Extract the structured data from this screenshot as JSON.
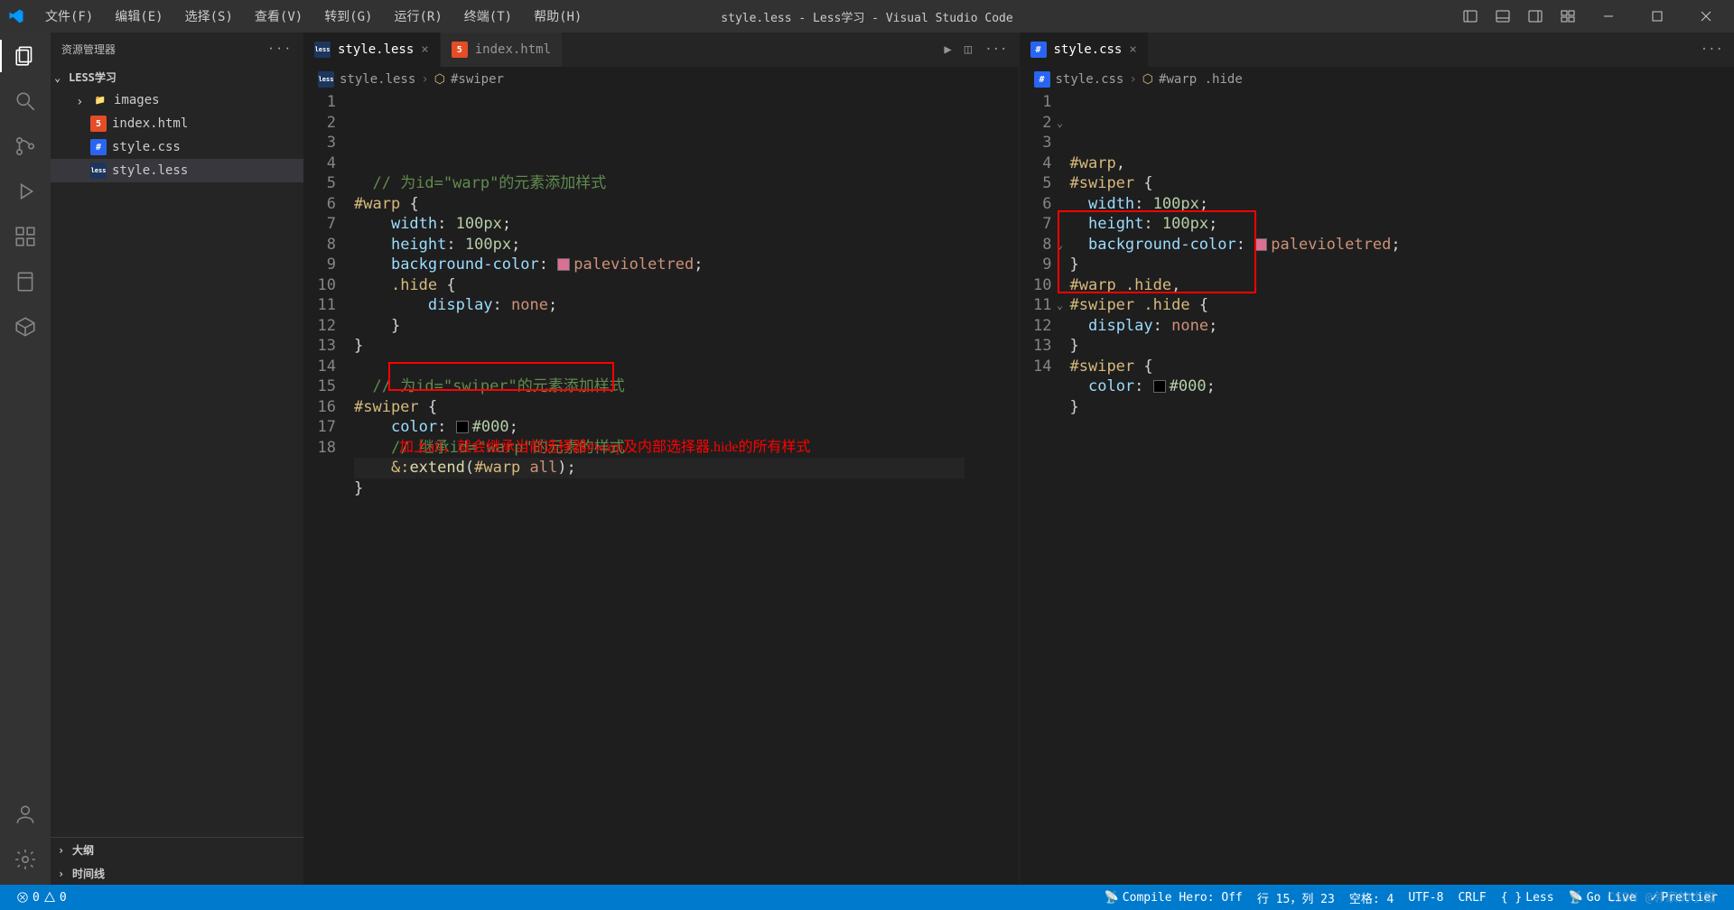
{
  "title": "style.less - Less学习 - Visual Studio Code",
  "menu": [
    "文件(F)",
    "编辑(E)",
    "选择(S)",
    "查看(V)",
    "转到(G)",
    "运行(R)",
    "终端(T)",
    "帮助(H)"
  ],
  "sidebar": {
    "header": "资源管理器",
    "folder": "LESS学习",
    "items": [
      {
        "label": "images",
        "icon": "folder",
        "indent": 1,
        "chev": true
      },
      {
        "label": "index.html",
        "icon": "html",
        "indent": 2,
        "chev": false
      },
      {
        "label": "style.css",
        "icon": "css",
        "indent": 2,
        "chev": false
      },
      {
        "label": "style.less",
        "icon": "less",
        "indent": 2,
        "chev": false,
        "selected": true
      }
    ],
    "collapse": [
      "大纲",
      "时间线"
    ]
  },
  "left_editor": {
    "tabs": [
      {
        "label": "style.less",
        "icon": "less",
        "active": true,
        "closable": true
      },
      {
        "label": "index.html",
        "icon": "html",
        "active": false,
        "closable": false
      }
    ],
    "breadcrumb": [
      "style.less",
      "#swiper"
    ],
    "lines": [
      {
        "n": 1,
        "html": "  <span class='c-comment'>// 为id=\"warp\"的元素添加样式</span>"
      },
      {
        "n": 2,
        "html": "<span class='c-selector'>#warp</span> <span class='c-punc'>{</span>"
      },
      {
        "n": 3,
        "html": "    <span class='c-prop'>width</span><span class='c-punc'>:</span> <span class='c-num'>100px</span><span class='c-punc'>;</span>"
      },
      {
        "n": 4,
        "html": "    <span class='c-prop'>height</span><span class='c-punc'>:</span> <span class='c-num'>100px</span><span class='c-punc'>;</span>"
      },
      {
        "n": 5,
        "html": "    <span class='c-prop'>background-color</span><span class='c-punc'>:</span> <span class='colorbox' style='background:#db7093'></span><span class='c-value'>palevioletred</span><span class='c-punc'>;</span>"
      },
      {
        "n": 6,
        "html": "    <span class='c-cls'>.hide</span> <span class='c-punc'>{</span>"
      },
      {
        "n": 7,
        "html": "        <span class='c-prop'>display</span><span class='c-punc'>:</span> <span class='c-value'>none</span><span class='c-punc'>;</span>"
      },
      {
        "n": 8,
        "html": "    <span class='c-punc'>}</span>"
      },
      {
        "n": 9,
        "html": "<span class='c-punc'>}</span>"
      },
      {
        "n": 10,
        "html": ""
      },
      {
        "n": 11,
        "html": "  <span class='c-comment'>// 为id=\"swiper\"的元素添加样式</span>"
      },
      {
        "n": 12,
        "html": "<span class='c-selector'>#swiper</span> <span class='c-punc'>{</span>"
      },
      {
        "n": 13,
        "html": "    <span class='c-prop'>color</span><span class='c-punc'>:</span> <span class='colorbox' style='background:#000'></span><span class='c-num'>#000</span><span class='c-punc'>;</span>"
      },
      {
        "n": 14,
        "html": "    <span class='c-comment'>// 继承id=\"warp\"的元素的样式</span>"
      },
      {
        "n": 15,
        "html": "    <span class='c-pseudo'>&:</span><span class='c-func'>extend</span><span class='c-punc'>(</span><span class='c-selector'>#warp</span> <span class='c-value'>all</span><span class='c-punc'>);</span>",
        "current": true
      },
      {
        "n": 16,
        "html": "<span class='c-punc'>}</span>"
      },
      {
        "n": 17,
        "html": ""
      },
      {
        "n": 18,
        "html": ""
      }
    ],
    "annotation": "加上all，就会继承当前选择器#warp及内部选择器.hide的所有样式",
    "highlight_box": {
      "top_line": 14.3,
      "height_lines": 1.4,
      "left_ch": 4,
      "width_ch": 26
    }
  },
  "right_editor": {
    "tabs": [
      {
        "label": "style.css",
        "icon": "css",
        "active": true,
        "closable": true
      }
    ],
    "breadcrumb": [
      "style.css",
      "#warp .hide"
    ],
    "lines": [
      {
        "n": 1,
        "html": "<span class='c-selector'>#warp</span><span class='c-punc'>,</span>"
      },
      {
        "n": 2,
        "fold": ">",
        "html": "<span class='c-selector'>#swiper</span> <span class='c-punc'>{</span>"
      },
      {
        "n": 3,
        "html": "  <span class='c-prop'>width</span><span class='c-punc'>:</span> <span class='c-num'>100px</span><span class='c-punc'>;</span>"
      },
      {
        "n": 4,
        "html": "  <span class='c-prop'>height</span><span class='c-punc'>:</span> <span class='c-num'>100px</span><span class='c-punc'>;</span>"
      },
      {
        "n": 5,
        "html": "  <span class='c-prop'>background-color</span><span class='c-punc'>:</span> <span class='colorbox' style='background:#db7093'></span><span class='c-value'>palevioletred</span><span class='c-punc'>;</span>"
      },
      {
        "n": 6,
        "html": "<span class='c-punc'>}</span>"
      },
      {
        "n": 7,
        "html": "<span class='c-selector'>#warp</span> <span class='c-cls'>.hide</span><span class='c-punc'>,</span>"
      },
      {
        "n": 8,
        "fold": ">",
        "html": "<span class='c-selector'>#swiper</span> <span class='c-cls'>.hide</span> <span class='c-punc'>{</span>"
      },
      {
        "n": 9,
        "html": "  <span class='c-prop'>display</span><span class='c-punc'>:</span> <span class='c-value'>none</span><span class='c-punc'>;</span>"
      },
      {
        "n": 10,
        "html": "<span class='c-punc'>}</span>"
      },
      {
        "n": 11,
        "fold": ">",
        "html": "<span class='c-selector'>#swiper</span> <span class='c-punc'>{</span>"
      },
      {
        "n": 12,
        "html": "  <span class='c-prop'>color</span><span class='c-punc'>:</span> <span class='colorbox' style='background:#000'></span><span class='c-num'>#000</span><span class='c-punc'>;</span>"
      },
      {
        "n": 13,
        "html": "<span class='c-punc'>}</span>"
      },
      {
        "n": 14,
        "html": ""
      }
    ],
    "highlight_box": {
      "top_line": 7,
      "height_lines": 4,
      "left_ch": 0,
      "width_ch": 23
    }
  },
  "status": {
    "errors": "0",
    "warnings": "0",
    "compile": "Compile Hero: Off",
    "pos": "行 15，列 23",
    "spaces": "空格: 4",
    "encoding": "UTF-8",
    "eol": "CRLF",
    "lang": "Less",
    "golive": "Go Live",
    "prettier": "Prettier"
  },
  "watermark": "CSDN @邻家的小猫"
}
